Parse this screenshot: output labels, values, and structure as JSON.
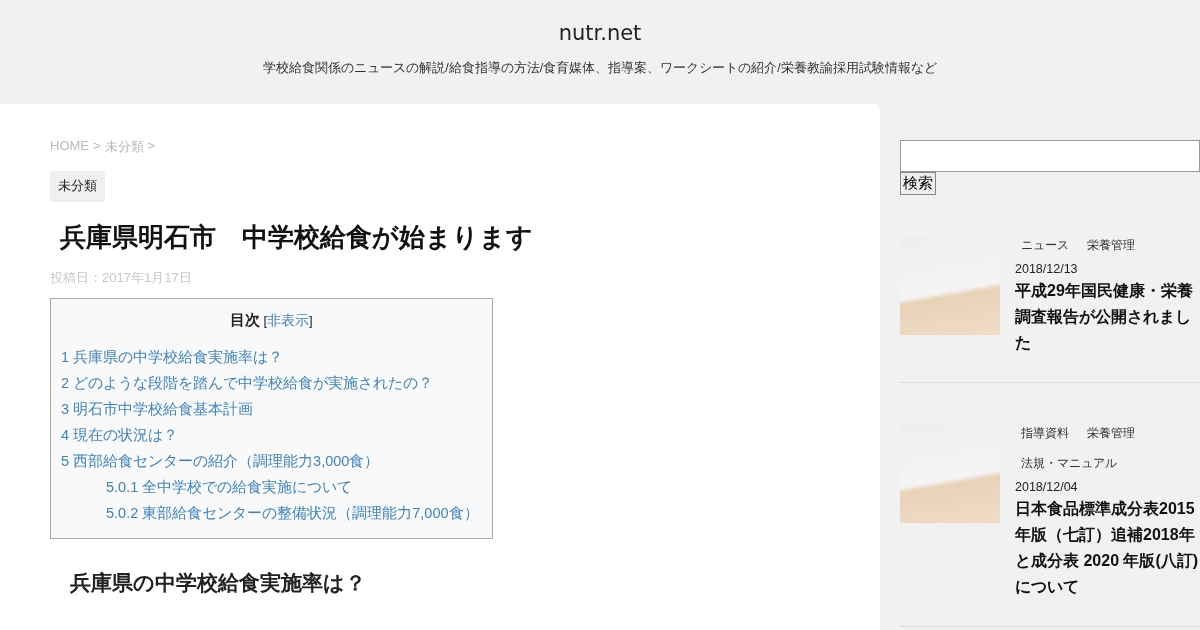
{
  "site": {
    "title": "nutr.net",
    "tagline": "学校給食関係のニュースの解説/給食指導の方法/食育媒体、指導案、ワークシートの紹介/栄養教諭採用試験情報など"
  },
  "breadcrumb": [
    "HOME",
    ">",
    "未分類",
    ">"
  ],
  "category": "未分類",
  "article": {
    "title": "兵庫県明石市　中学校給食が始まります",
    "date": "投稿日：2017年1月17日"
  },
  "toc": {
    "heading": "目次",
    "toggle_open": "[",
    "toggle": "非表示",
    "toggle_close": "]",
    "items": [
      {
        "text": "1 兵庫県の中学校給食実施率は？"
      },
      {
        "text": "2 どのような段階を踏んで中学校給食が実施されたの？"
      },
      {
        "text": "3 明石市中学校給食基本計画"
      },
      {
        "text": "4 現在の状況は？"
      },
      {
        "text": "5 西部給食センターの紹介（調理能力3,000食）",
        "children": [
          {
            "text": "5.0.1 全中学校での給食実施について"
          },
          {
            "text": "5.0.2 東部給食センターの整備状況（調理能力7,000食）"
          }
        ]
      }
    ]
  },
  "section_heading": "兵庫県の中学校給食実施率は？",
  "sidebar": {
    "search": {
      "button": "検索"
    },
    "posts": [
      {
        "tags": [
          "ニュース",
          "栄養管理"
        ],
        "date": "2018/12/13",
        "title": "平成29年国民健康・栄養調査報告が公開されました"
      },
      {
        "tags": [
          "指導資料",
          "栄養管理",
          "法規・マニュアル"
        ],
        "date": "2018/12/04",
        "title": "日本食品標準成分表2015年版（七訂）追補2018年と成分表 2020 年版(八訂)について"
      }
    ]
  }
}
